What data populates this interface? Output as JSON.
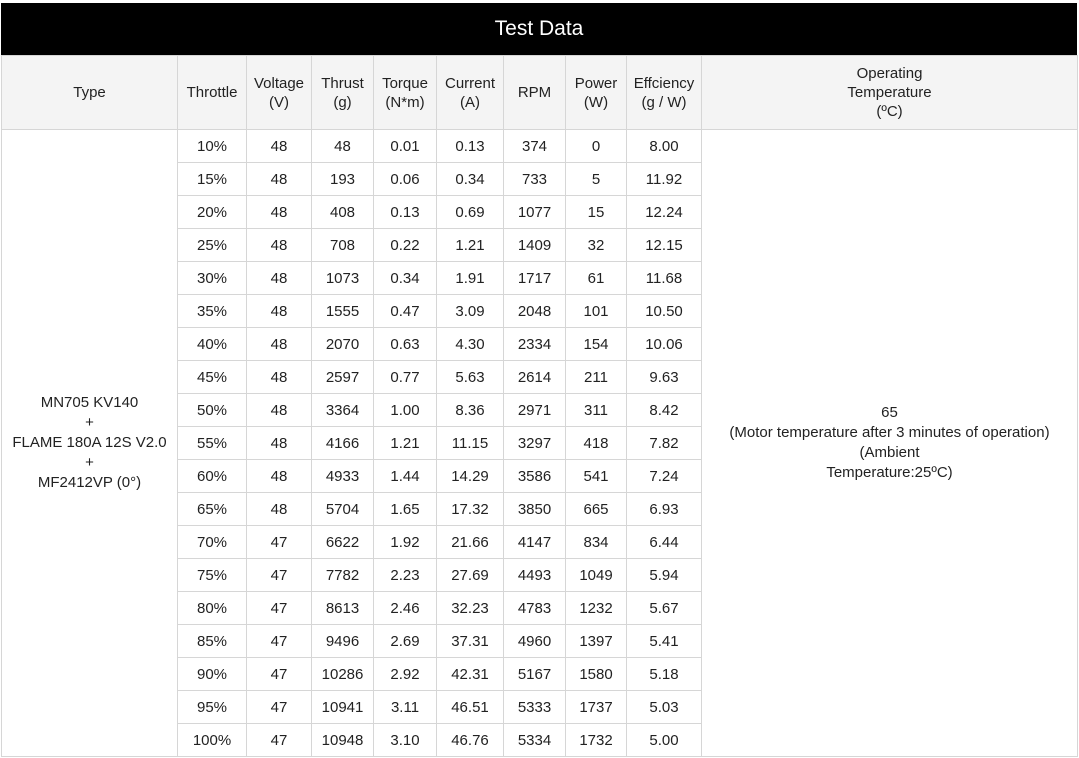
{
  "title": "Test Data",
  "headers": {
    "type": "Type",
    "throttle": "Throttle",
    "voltage": [
      "Voltage",
      "(V)"
    ],
    "thrust": [
      "Thrust",
      "(g)"
    ],
    "torque": [
      "Torque",
      "(N*m)"
    ],
    "current": [
      "Current",
      "(A)"
    ],
    "rpm": "RPM",
    "power": [
      "Power",
      "(W)"
    ],
    "efficiency": [
      "Effciency",
      "(g / W)"
    ],
    "operating_temperature": [
      "Operating",
      "Temperature",
      "(ºC)"
    ]
  },
  "type_cell": [
    "MN705 KV140",
    "+",
    "FLAME 180A 12S V2.0",
    "+",
    "MF2412VP (0°)"
  ],
  "temperature_cell": [
    "65",
    "(Motor temperature after 3 minutes of operation)",
    "(Ambient",
    "Temperature:25ºC)"
  ],
  "rows": [
    [
      "10%",
      "48",
      "48",
      "0.01",
      "0.13",
      "374",
      "0",
      "8.00"
    ],
    [
      "15%",
      "48",
      "193",
      "0.06",
      "0.34",
      "733",
      "5",
      "11.92"
    ],
    [
      "20%",
      "48",
      "408",
      "0.13",
      "0.69",
      "1077",
      "15",
      "12.24"
    ],
    [
      "25%",
      "48",
      "708",
      "0.22",
      "1.21",
      "1409",
      "32",
      "12.15"
    ],
    [
      "30%",
      "48",
      "1073",
      "0.34",
      "1.91",
      "1717",
      "61",
      "11.68"
    ],
    [
      "35%",
      "48",
      "1555",
      "0.47",
      "3.09",
      "2048",
      "101",
      "10.50"
    ],
    [
      "40%",
      "48",
      "2070",
      "0.63",
      "4.30",
      "2334",
      "154",
      "10.06"
    ],
    [
      "45%",
      "48",
      "2597",
      "0.77",
      "5.63",
      "2614",
      "211",
      "9.63"
    ],
    [
      "50%",
      "48",
      "3364",
      "1.00",
      "8.36",
      "2971",
      "311",
      "8.42"
    ],
    [
      "55%",
      "48",
      "4166",
      "1.21",
      "11.15",
      "3297",
      "418",
      "7.82"
    ],
    [
      "60%",
      "48",
      "4933",
      "1.44",
      "14.29",
      "3586",
      "541",
      "7.24"
    ],
    [
      "65%",
      "48",
      "5704",
      "1.65",
      "17.32",
      "3850",
      "665",
      "6.93"
    ],
    [
      "70%",
      "47",
      "6622",
      "1.92",
      "21.66",
      "4147",
      "834",
      "6.44"
    ],
    [
      "75%",
      "47",
      "7782",
      "2.23",
      "27.69",
      "4493",
      "1049",
      "5.94"
    ],
    [
      "80%",
      "47",
      "8613",
      "2.46",
      "32.23",
      "4783",
      "1232",
      "5.67"
    ],
    [
      "85%",
      "47",
      "9496",
      "2.69",
      "37.31",
      "4960",
      "1397",
      "5.41"
    ],
    [
      "90%",
      "47",
      "10286",
      "2.92",
      "42.31",
      "5167",
      "1580",
      "5.18"
    ],
    [
      "95%",
      "47",
      "10941",
      "3.11",
      "46.51",
      "5333",
      "1737",
      "5.03"
    ],
    [
      "100%",
      "47",
      "10948",
      "3.10",
      "46.76",
      "5334",
      "1732",
      "5.00"
    ]
  ]
}
